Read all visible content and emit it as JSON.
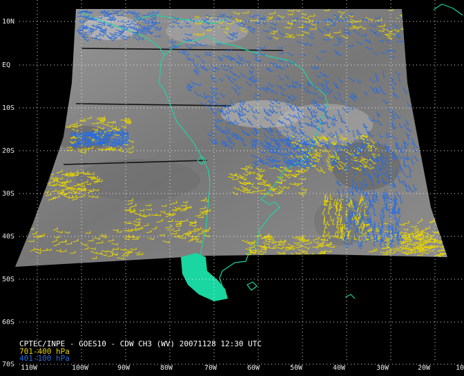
{
  "title": "CPTEC/INPE - GOES10 - CDW CH3 (WV) 20071128 12:30 UTC",
  "legend": [
    {
      "label": "701-400 hPa",
      "color": "#e6d400"
    },
    {
      "label": "401-100 hPa",
      "color": "#2a6cdc"
    }
  ],
  "lat_labels": [
    "10N",
    "EQ",
    "10S",
    "20S",
    "30S",
    "40S",
    "50S",
    "60S",
    "70S"
  ],
  "lon_labels": [
    "110W",
    "100W",
    "90W",
    "80W",
    "70W",
    "60W",
    "50W",
    "40W",
    "30W",
    "20W",
    "10"
  ],
  "colors": {
    "background": "#000000",
    "coastline": "#1ad6a0",
    "grid": "#ffffff",
    "wv_image": "#8a8a8a"
  }
}
